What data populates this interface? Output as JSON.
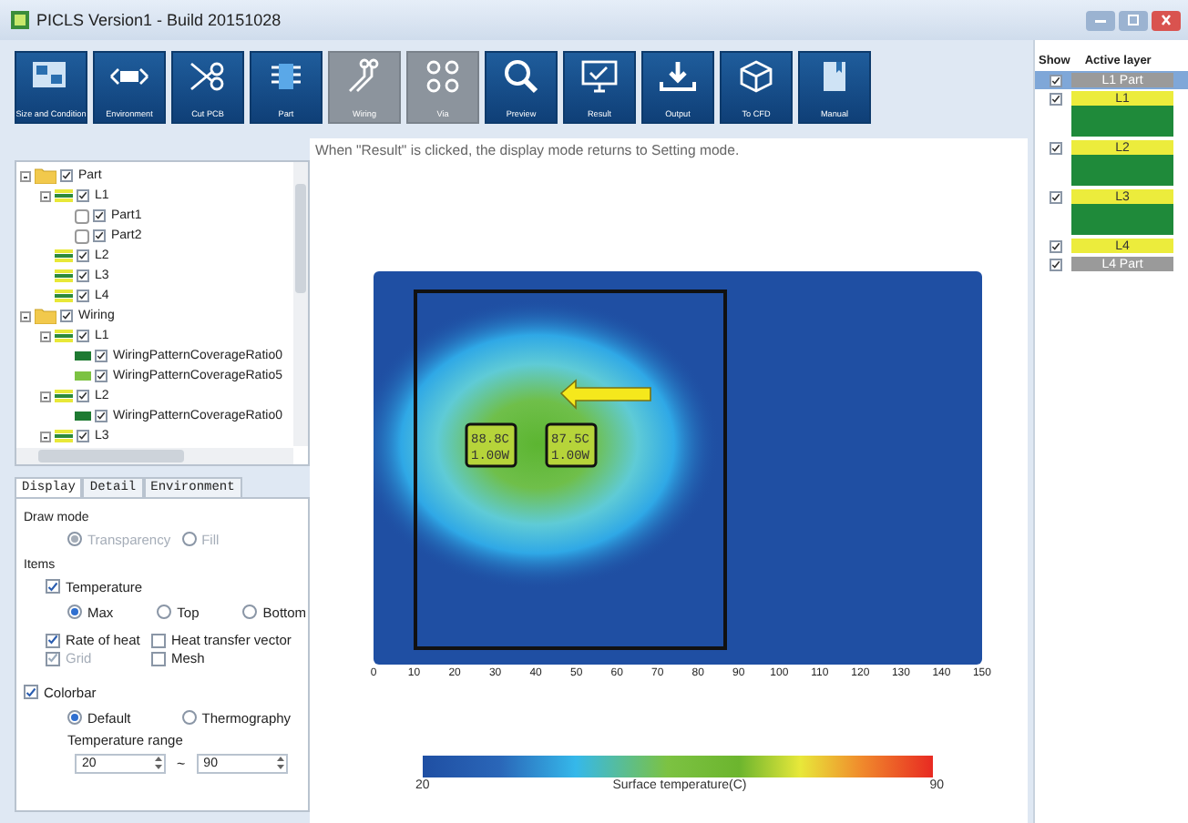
{
  "window": {
    "title": "PICLS Version1 - Build 20151028"
  },
  "toolbar": [
    {
      "label": "Size and Condition",
      "kind": "board",
      "disabled": false
    },
    {
      "label": "Environment",
      "kind": "environment",
      "disabled": false
    },
    {
      "label": "Cut PCB",
      "kind": "scissors",
      "disabled": false
    },
    {
      "label": "Part",
      "kind": "chip",
      "disabled": false
    },
    {
      "label": "Wiring",
      "kind": "wiring",
      "disabled": true
    },
    {
      "label": "Via",
      "kind": "via",
      "disabled": true
    },
    {
      "label": "Preview",
      "kind": "magnifier",
      "disabled": false
    },
    {
      "label": "Result",
      "kind": "monitor",
      "disabled": false
    },
    {
      "label": "Output",
      "kind": "download",
      "disabled": false
    },
    {
      "label": "To CFD",
      "kind": "cube",
      "disabled": false
    },
    {
      "label": "Manual",
      "kind": "book",
      "disabled": false
    }
  ],
  "tree": [
    {
      "label": "Part",
      "kind": "folder",
      "checked": true,
      "expanded": true,
      "children": [
        {
          "label": "L1",
          "kind": "layer",
          "checked": true,
          "expanded": true,
          "children": [
            {
              "label": "Part1",
              "kind": "part",
              "checked": true
            },
            {
              "label": "Part2",
              "kind": "part",
              "checked": true
            }
          ]
        },
        {
          "label": "L2",
          "kind": "layer",
          "checked": true
        },
        {
          "label": "L3",
          "kind": "layer",
          "checked": true
        },
        {
          "label": "L4",
          "kind": "layer",
          "checked": true
        }
      ]
    },
    {
      "label": "Wiring",
      "kind": "folder",
      "checked": true,
      "expanded": true,
      "children": [
        {
          "label": "L1",
          "kind": "layer",
          "checked": true,
          "expanded": true,
          "children": [
            {
              "label": "WiringPatternCoverageRatio0",
              "kind": "pattern",
              "color": "#1e7a32",
              "checked": true
            },
            {
              "label": "WiringPatternCoverageRatio5",
              "kind": "pattern",
              "color": "#7cc242",
              "checked": true
            }
          ]
        },
        {
          "label": "L2",
          "kind": "layer",
          "checked": true,
          "expanded": true,
          "children": [
            {
              "label": "WiringPatternCoverageRatio0",
              "kind": "pattern",
              "color": "#1e7a32",
              "checked": true
            }
          ]
        },
        {
          "label": "L3",
          "kind": "layer",
          "checked": true,
          "expanded": true
        }
      ]
    }
  ],
  "settings": {
    "tabs": [
      {
        "label": "Display",
        "selected": true
      },
      {
        "label": "Detail",
        "selected": false
      },
      {
        "label": "Environment",
        "selected": false
      }
    ],
    "draw_mode": {
      "label": "Draw mode",
      "options": [
        {
          "label": "Transparency",
          "selected": true,
          "disabled": true
        },
        {
          "label": "Fill",
          "selected": false,
          "disabled": true
        }
      ]
    },
    "items": {
      "label": "Items",
      "temperature": {
        "label": "Temperature",
        "checked": true
      },
      "positions": [
        {
          "label": "Max",
          "selected": true
        },
        {
          "label": "Top",
          "selected": false
        },
        {
          "label": "Bottom",
          "selected": false
        }
      ],
      "options": [
        {
          "label": "Rate of heat",
          "checked": true,
          "disabled": false
        },
        {
          "label": "Heat transfer vector",
          "checked": false,
          "disabled": false
        },
        {
          "label": "Grid",
          "checked": true,
          "disabled": true
        },
        {
          "label": "Mesh",
          "checked": false,
          "disabled": false
        }
      ]
    },
    "colorbar": {
      "label": "Colorbar",
      "checked": true,
      "modes": [
        {
          "label": "Default",
          "selected": true
        },
        {
          "label": "Thermography",
          "selected": false
        }
      ],
      "range_label": "Temperature range",
      "min": "20",
      "separator": "~",
      "max": "90"
    }
  },
  "main": {
    "message": "When \"Result\" is clicked, the display mode returns to Setting mode.",
    "parts": [
      {
        "temperature": "88.8C",
        "power": "1.00W"
      },
      {
        "temperature": "87.5C",
        "power": "1.00W"
      }
    ],
    "x_ticks": [
      "0",
      "10",
      "20",
      "30",
      "40",
      "50",
      "60",
      "70",
      "80",
      "90",
      "100",
      "110",
      "120",
      "130",
      "140",
      "150"
    ],
    "colorbar": {
      "min": "20",
      "title": "Surface temperature(C)",
      "max": "90"
    }
  },
  "layers": {
    "show_header": "Show",
    "active_header": "Active layer",
    "rows": [
      {
        "label": "L1 Part",
        "kind": "part",
        "show": true,
        "selected": true
      },
      {
        "label": "L1",
        "kind": "layer",
        "show": true,
        "selected": false
      },
      {
        "label": "L2",
        "kind": "layer",
        "show": true,
        "selected": false
      },
      {
        "label": "L3",
        "kind": "layer",
        "show": true,
        "selected": false
      },
      {
        "label": "L4",
        "kind": "layer",
        "show": true,
        "selected": false
      },
      {
        "label": "L4 Part",
        "kind": "part",
        "show": true,
        "selected": false
      }
    ]
  }
}
